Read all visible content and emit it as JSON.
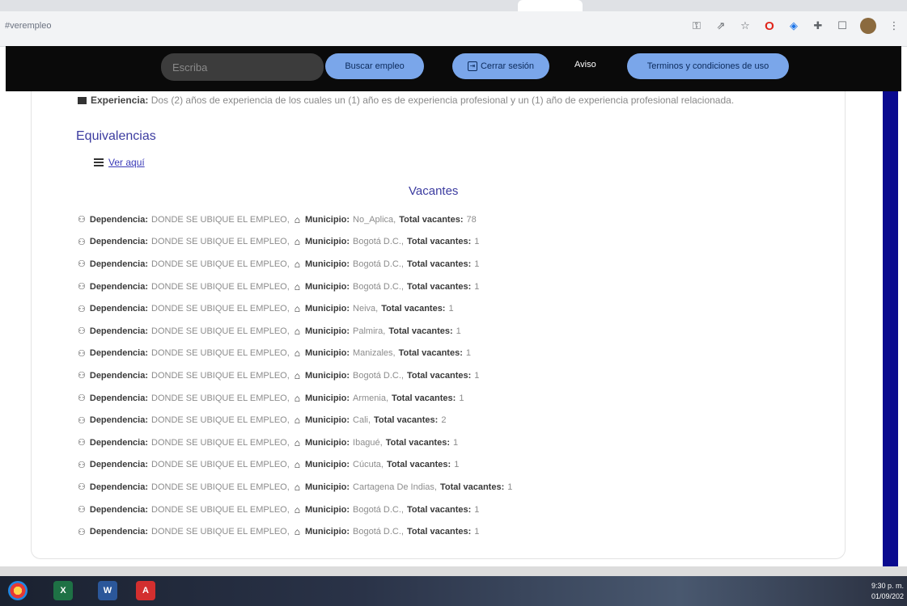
{
  "browser": {
    "address_text": "#verempleo",
    "icons": [
      "key-icon",
      "share-icon",
      "star-icon",
      "opera-icon",
      "extension-icon",
      "puzzle-icon",
      "sidebar-icon",
      "profile-avatar",
      "menu-icon"
    ]
  },
  "navbar": {
    "search_placeholder": "Escriba",
    "buscar_label": "Buscar empleo",
    "cerrar_label": "Cerrar sesión",
    "aviso_label": "Aviso",
    "terminos_label": "Terminos y condiciones de uso"
  },
  "content": {
    "experiencia_label": "Experiencia:",
    "experiencia_text": "Dos (2) años de experiencia de los cuales un (1) año es de experiencia profesional y un (1) año de experiencia profesional relacionada.",
    "equivalencias_title": "Equivalencias",
    "ver_link": "Ver aquí",
    "vacantes_title": "Vacantes",
    "labels": {
      "dependencia": "Dependencia:",
      "municipio": "Municipio:",
      "total": "Total vacantes:"
    },
    "vacantes": [
      {
        "dependencia": "DONDE SE UBIQUE EL EMPLEO,",
        "municipio": "No_Aplica,",
        "total": "78"
      },
      {
        "dependencia": "DONDE SE UBIQUE EL EMPLEO,",
        "municipio": "Bogotá D.C.,",
        "total": "1"
      },
      {
        "dependencia": "DONDE SE UBIQUE EL EMPLEO,",
        "municipio": "Bogotá D.C.,",
        "total": "1"
      },
      {
        "dependencia": "DONDE SE UBIQUE EL EMPLEO,",
        "municipio": "Bogotá D.C.,",
        "total": "1"
      },
      {
        "dependencia": "DONDE SE UBIQUE EL EMPLEO,",
        "municipio": "Neiva,",
        "total": "1"
      },
      {
        "dependencia": "DONDE SE UBIQUE EL EMPLEO,",
        "municipio": "Palmira,",
        "total": "1"
      },
      {
        "dependencia": "DONDE SE UBIQUE EL EMPLEO,",
        "municipio": "Manizales,",
        "total": "1"
      },
      {
        "dependencia": "DONDE SE UBIQUE EL EMPLEO,",
        "municipio": "Bogotá D.C.,",
        "total": "1"
      },
      {
        "dependencia": "DONDE SE UBIQUE EL EMPLEO,",
        "municipio": "Armenia,",
        "total": "1"
      },
      {
        "dependencia": "DONDE SE UBIQUE EL EMPLEO,",
        "municipio": "Cali,",
        "total": "2"
      },
      {
        "dependencia": "DONDE SE UBIQUE EL EMPLEO,",
        "municipio": "Ibagué,",
        "total": "1"
      },
      {
        "dependencia": "DONDE SE UBIQUE EL EMPLEO,",
        "municipio": "Cúcuta,",
        "total": "1"
      },
      {
        "dependencia": "DONDE SE UBIQUE EL EMPLEO,",
        "municipio": "Cartagena De Indias,",
        "total": "1"
      },
      {
        "dependencia": "DONDE SE UBIQUE EL EMPLEO,",
        "municipio": "Bogotá D.C.,",
        "total": "1"
      },
      {
        "dependencia": "DONDE SE UBIQUE EL EMPLEO,",
        "municipio": "Bogotá D.C.,",
        "total": "1"
      }
    ]
  },
  "taskbar": {
    "apps": [
      "start-icon",
      "excel-icon",
      "word-icon",
      "pdf-icon"
    ],
    "excel_glyph": "X",
    "word_glyph": "W",
    "pdf_glyph": "A",
    "time": "9:30 p. m.",
    "date": "01/09/202"
  },
  "colors": {
    "navbar_bg": "#0a0a0a",
    "pill_bg": "#7aa6ea",
    "heading": "#3c3ca0",
    "scroll_thumb": "#0a0a8f"
  }
}
